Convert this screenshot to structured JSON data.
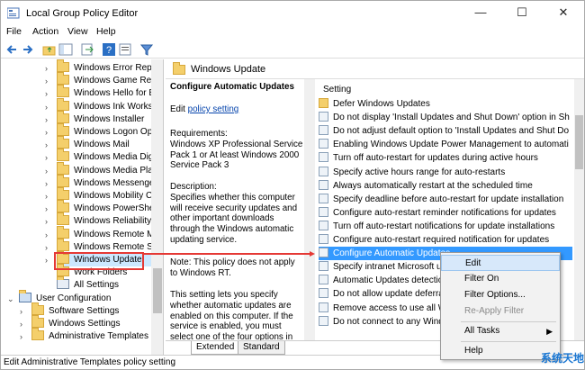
{
  "window": {
    "title": "Local Group Policy Editor",
    "minimize_glyph": "—",
    "maximize_glyph": "☐",
    "close_glyph": "✕"
  },
  "menus": [
    "File",
    "Action",
    "View",
    "Help"
  ],
  "toolbar_icons": [
    "back-icon",
    "forward-icon",
    "folder-up-icon",
    "show-tree-icon",
    "export-icon",
    "help-icon",
    "properties-icon",
    "filter-icon"
  ],
  "tree": {
    "items": [
      "Windows Error Repo",
      "Windows Game Rec",
      "Windows Hello for B",
      "Windows Ink Worksp",
      "Windows Installer",
      "Windows Logon Opt",
      "Windows Mail",
      "Windows Media Dig",
      "Windows Media Pla",
      "Windows Messenger",
      "Windows Mobility C",
      "Windows PowerShel",
      "Windows Reliability",
      "Windows Remote M",
      "Windows Remote Sh",
      "Windows Update",
      "Work Folders",
      "All Settings",
      "User Configuration",
      "Software Settings",
      "Windows Settings",
      "Administrative Templates"
    ]
  },
  "right": {
    "header": "Windows Update",
    "desc_title": "Configure Automatic Updates",
    "edit_prefix": "Edit",
    "edit_link": "policy setting",
    "requirements": "Requirements:\nWindows XP Professional Service Pack 1 or At least Windows 2000 Service Pack 3",
    "description": "Description:\nSpecifies whether this computer will receive security updates and other important downloads through the Windows automatic updating service.",
    "note": "Note: This policy does not apply to Windows RT.",
    "more": "This setting lets you specify whether automatic updates are enabled on this computer. If the service is enabled, you must select one of the four options in the",
    "settings_header": "Setting",
    "settings": [
      "Defer Windows Updates",
      "Do not display 'Install Updates and Shut Down' option in Sh",
      "Do not adjust default option to 'Install Updates and Shut Do",
      "Enabling Windows Update Power Management to automati",
      "Turn off auto-restart for updates during active hours",
      "Specify active hours range for auto-restarts",
      "Always automatically restart at the scheduled time",
      "Specify deadline before auto-restart for update installation",
      "Configure auto-restart reminder notifications for updates",
      "Turn off auto-restart notifications for update installations",
      "Configure auto-restart required notification for updates",
      "Configure Automatic Updates",
      "Specify intranet Microsoft up",
      "Automatic Updates detectio",
      "Do not allow update deferra",
      "Remove access to use all Wi",
      "Do not connect to any Wind"
    ],
    "tabs": [
      "Extended",
      "Standard"
    ]
  },
  "context_menu": {
    "items": [
      "Edit",
      "Filter On",
      "Filter Options...",
      "Re-Apply Filter",
      "All Tasks",
      "Help"
    ]
  },
  "status": "Edit Administrative Templates policy setting",
  "watermark": "系统天地",
  "colors": {
    "selection": "#3399ff",
    "highlight_box": "#e53935",
    "link": "#0645ad"
  }
}
